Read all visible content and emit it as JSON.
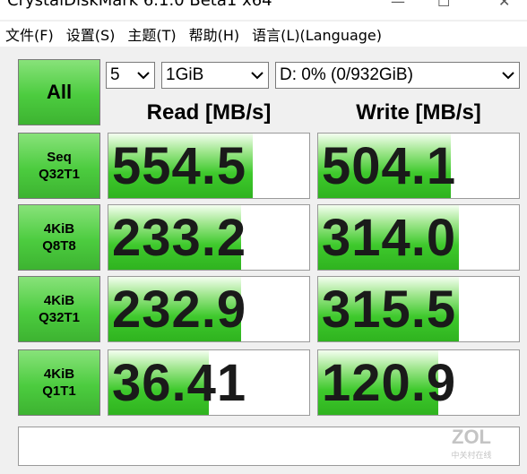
{
  "window": {
    "title": "CrystalDiskMark 6.1.0 Beta1 x64"
  },
  "menu": [
    {
      "label": "文件(F)"
    },
    {
      "label": "设置(S)"
    },
    {
      "label": "主题(T)"
    },
    {
      "label": "帮助(H)"
    },
    {
      "label": "语言(L)(Language)"
    }
  ],
  "controls": {
    "all_label": "All",
    "count": "5",
    "size": "1GiB",
    "drive": "D: 0% (0/932GiB)"
  },
  "headers": {
    "read": "Read [MB/s]",
    "write": "Write [MB/s]"
  },
  "tests": [
    {
      "line1": "Seq",
      "line2": "Q32T1",
      "read": "554.5",
      "write": "504.1",
      "read_fill": 0.72,
      "write_fill": 0.66
    },
    {
      "line1": "4KiB",
      "line2": "Q8T8",
      "read": "233.2",
      "write": "314.0",
      "read_fill": 0.66,
      "write_fill": 0.7
    },
    {
      "line1": "4KiB",
      "line2": "Q32T1",
      "read": "232.9",
      "write": "315.5",
      "read_fill": 0.66,
      "write_fill": 0.7
    },
    {
      "line1": "4KiB",
      "line2": "Q1T1",
      "read": "36.41",
      "write": "120.9",
      "read_fill": 0.5,
      "write_fill": 0.6
    }
  ],
  "watermark": {
    "brand": "ZOL",
    "sub": "中关村在线"
  }
}
